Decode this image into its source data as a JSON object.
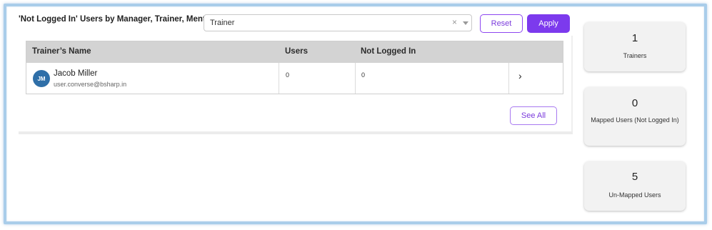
{
  "header": {
    "title": "'Not Logged In' Users by Manager, Trainer, Mentor"
  },
  "filter": {
    "selected": "Trainer",
    "clear_icon": "clear-icon",
    "dropdown_icon": "chevron-down-icon"
  },
  "actions": {
    "reset_label": "Reset",
    "apply_label": "Apply",
    "see_all_label": "See All"
  },
  "table": {
    "columns": [
      "Trainer’s Name",
      "Users",
      "Not Logged In"
    ],
    "rows": [
      {
        "initials": "JM",
        "name": "Jacob Miller",
        "email": "user.converse@bsharp.in",
        "users": "0",
        "not_logged_in": "0"
      }
    ]
  },
  "stats": [
    {
      "value": "1",
      "label": "Trainers"
    },
    {
      "value": "0",
      "label": "Mapped Users (Not Logged In)"
    },
    {
      "value": "5",
      "label": "Un-Mapped Users"
    }
  ],
  "colors": {
    "accent": "#7c3aed",
    "avatar": "#2f6fa8",
    "frame_border": "#a9cdea"
  }
}
